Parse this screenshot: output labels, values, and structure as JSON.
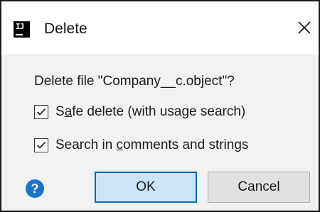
{
  "window": {
    "title": "Delete",
    "app_icon_text": "IJ",
    "close_icon": "close-icon"
  },
  "dialog": {
    "message": "Delete file \"Company__c.object\"?",
    "options": [
      {
        "pre": "S",
        "mnemonic": "a",
        "post": "fe delete (with usage search)",
        "checked": true
      },
      {
        "pre": "Search in ",
        "mnemonic": "c",
        "post": "omments and strings",
        "checked": true
      }
    ]
  },
  "buttons": {
    "help_label": "?",
    "ok_label": "OK",
    "cancel_label": "Cancel"
  },
  "colors": {
    "help_blue": "#1a73c8",
    "ok_border": "#0a66b7",
    "ok_fill": "#cce4f7",
    "dialog_bg": "#f2f2f2"
  }
}
